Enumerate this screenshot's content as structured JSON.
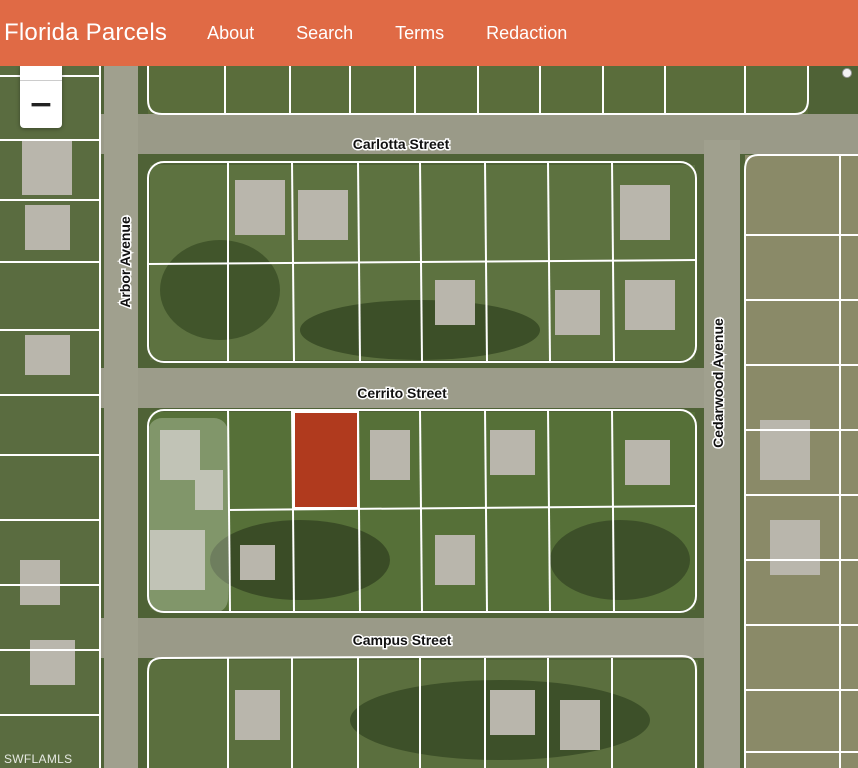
{
  "header": {
    "brand": "Florida Parcels",
    "nav": [
      "About",
      "Search",
      "Terms",
      "Redaction"
    ]
  },
  "map": {
    "zoom_out_label": "−",
    "streets": {
      "carlotta": "Carlotta Street",
      "cerrito": "Cerrito Street",
      "campus": "Campus Street",
      "arbor": "Arbor Avenue",
      "cedarwood": "Cedarwood Avenue"
    },
    "highlight_color": "#c0301a"
  },
  "watermark": "SWFLAMLS"
}
